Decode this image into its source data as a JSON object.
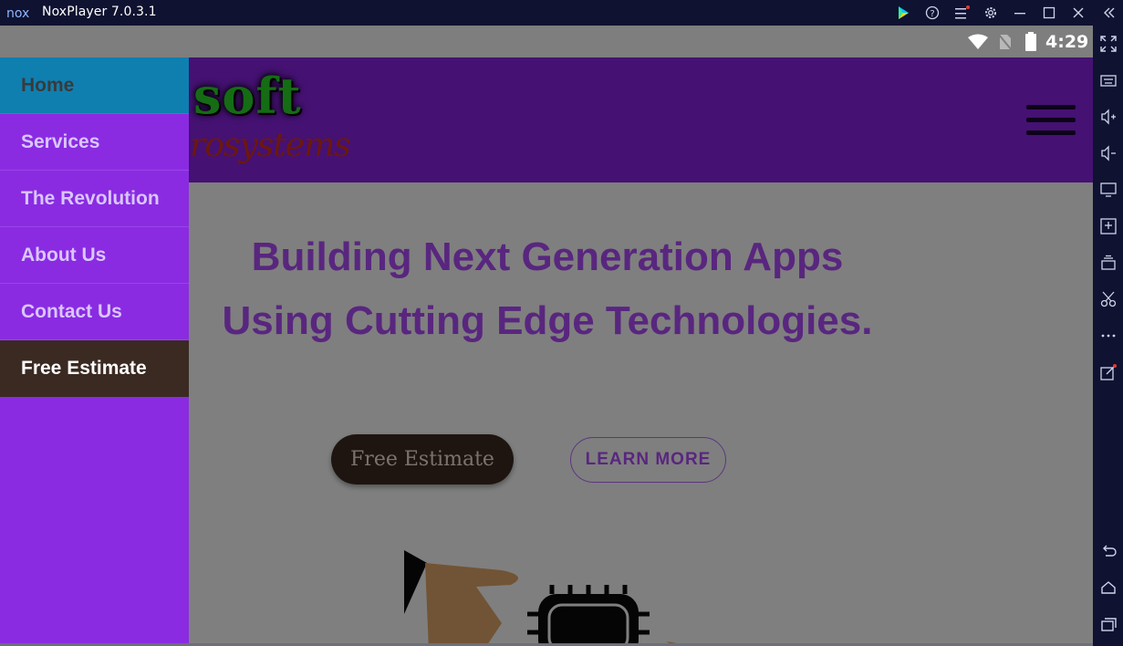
{
  "window": {
    "title": "NoxPlayer 7.0.3.1",
    "logo_text": "nox",
    "buttons": [
      "play-icon",
      "help-icon",
      "menu-icon",
      "settings-icon",
      "minimize-icon",
      "maximize-icon",
      "close-icon"
    ],
    "notification_color": "#e53935"
  },
  "status_bar": {
    "time": "4:29",
    "icons": [
      "wifi-icon",
      "no-sim-icon",
      "battery-icon"
    ]
  },
  "site": {
    "header_color": "#8a23e6",
    "logo": {
      "main": "soft",
      "sub": "rosystems"
    },
    "headline_line1": "Building Next Generation Apps",
    "headline_line2": "Using Cutting Edge Technologies.",
    "primary_button": "Free Estimate",
    "secondary_button": "LEARN MORE"
  },
  "side_menu": {
    "items": [
      {
        "label": "Home",
        "state": "highlighted"
      },
      {
        "label": "Services"
      },
      {
        "label": "The Revolution"
      },
      {
        "label": "About Us"
      },
      {
        "label": "Contact Us"
      },
      {
        "label": "Free Estimate",
        "state": "dark"
      }
    ]
  },
  "right_toolbar": {
    "icons": [
      "collapse-icon",
      "fullscreen-icon",
      "keyboard-icon",
      "volume-up-icon",
      "volume-down-icon",
      "screen-icon",
      "add-apk-icon",
      "multi-instance-icon",
      "screenshot-icon",
      "more-icon",
      "shortcut-icon",
      "back-icon",
      "home-icon",
      "recent-apps-icon"
    ]
  }
}
